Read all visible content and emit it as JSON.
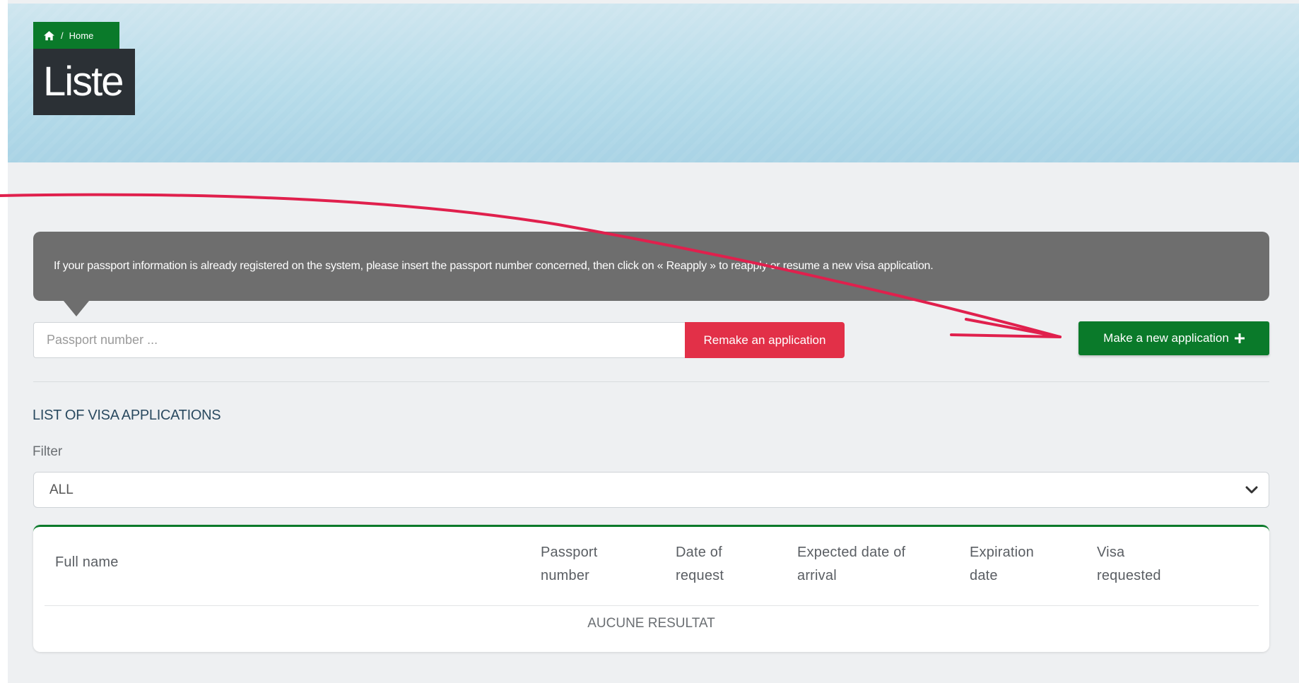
{
  "header": {
    "breadcrumb_label": "Home",
    "page_title": "Liste"
  },
  "info": {
    "message": "If your passport information is already registered on the system, please insert the passport number concerned, then click on « Reapply » to reapply or resume a new visa application."
  },
  "passport": {
    "placeholder": "Passport number ...",
    "remake_label": "Remake an application",
    "new_label": "Make a new application"
  },
  "list": {
    "title": "LIST OF VISA APPLICATIONS",
    "filter_label": "Filter",
    "filter_value": "ALL"
  },
  "table": {
    "columns": [
      {
        "line1": "Full name",
        "line2": ""
      },
      {
        "line1": "Passport",
        "line2": "number"
      },
      {
        "line1": "Date of",
        "line2": "request"
      },
      {
        "line1": "Expected date of",
        "line2": "arrival"
      },
      {
        "line1": "Expiration",
        "line2": "date"
      },
      {
        "line1": "Visa",
        "line2": "requested"
      }
    ],
    "empty_text": "AUCUNE RESULTAT"
  },
  "colors": {
    "brand_green": "#0a7a2a",
    "danger_red": "#e23048",
    "annotation_arrow": "#e0204d"
  },
  "icons": {
    "breadcrumb": "home-icon",
    "new_application": "plus-icon",
    "filter": "chevron-down-icon"
  }
}
